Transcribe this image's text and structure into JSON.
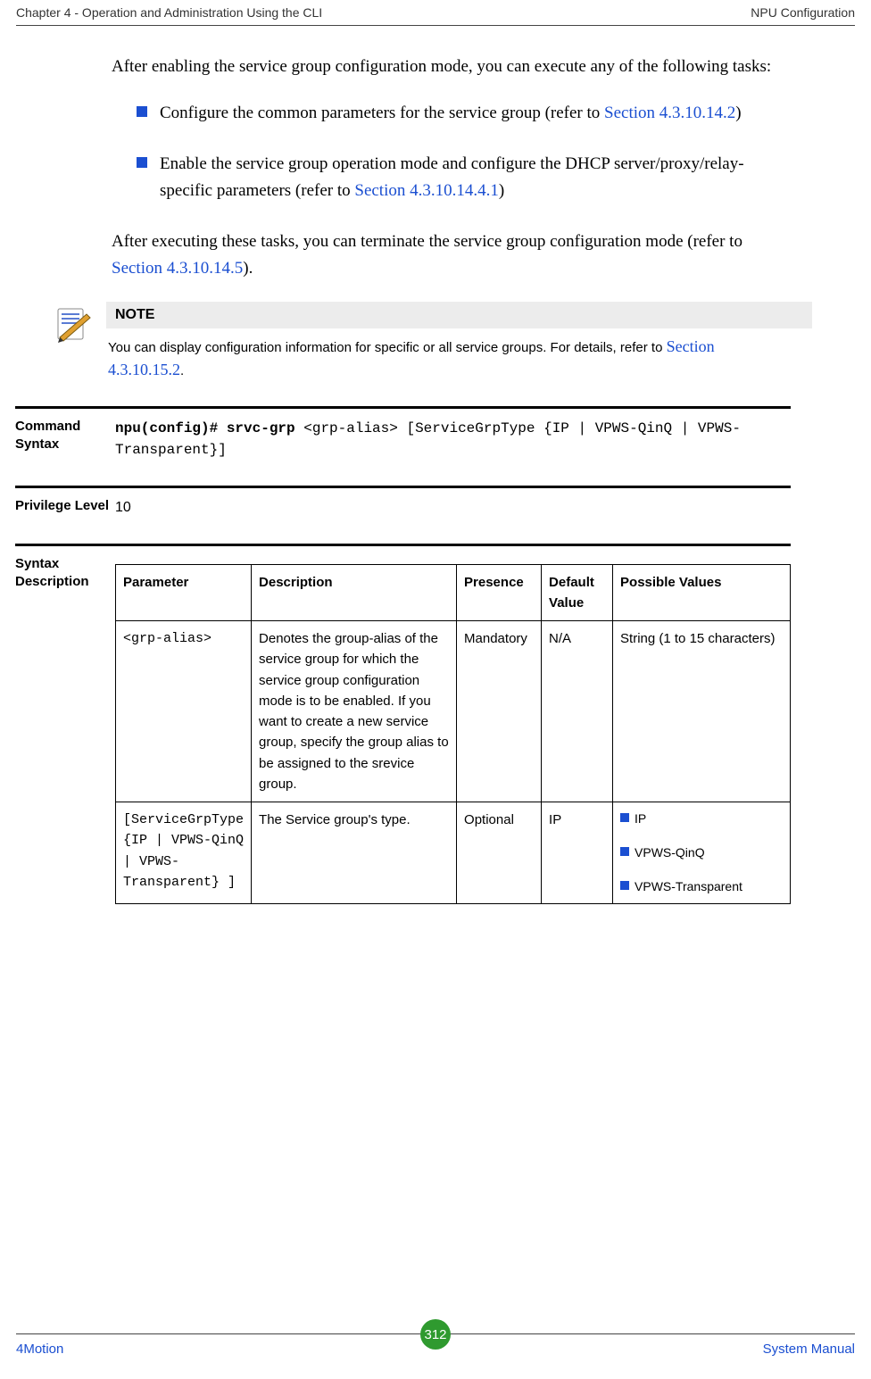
{
  "header": {
    "left": "Chapter 4 - Operation and Administration Using the CLI",
    "right": "NPU Configuration"
  },
  "intro": {
    "lead": "After enabling the service group configuration mode, you can execute any of the following tasks:",
    "bullets": [
      {
        "pre": "Configure the common parameters for the service group (refer to ",
        "link": "Section 4.3.10.14.2",
        "post": ")"
      },
      {
        "pre": "Enable the service group operation mode and configure the DHCP server/proxy/relay-specific parameters (refer to ",
        "link": "Section 4.3.10.14.4.1",
        "post": ")"
      }
    ],
    "after_pre": "After executing these tasks, you can terminate the service group configuration mode (refer to ",
    "after_link": "Section 4.3.10.14.5",
    "after_post": ")."
  },
  "note": {
    "title": "NOTE",
    "text_pre": "You can display configuration information for specific or all service groups. For details, refer to ",
    "link": "Section 4.3.10.15.2",
    "text_post": "."
  },
  "defs": {
    "command_syntax_label": "Command Syntax",
    "command_syntax_bold": "npu(config)# srvc-grp",
    "command_syntax_rest": " <grp-alias> [ServiceGrpType {IP | VPWS-QinQ | VPWS-Transparent}]",
    "privilege_level_label": "Privilege Level",
    "privilege_level_value": "10",
    "syntax_description_label": "Syntax Description"
  },
  "syntax_table": {
    "headers": {
      "parameter": "Parameter",
      "description": "Description",
      "presence": "Presence",
      "default_value": "Default Value",
      "possible_values": "Possible Values"
    },
    "rows": [
      {
        "parameter": "<grp-alias>",
        "description": "Denotes the group-alias of the service group for which the service group configuration mode is to be enabled. If you want to create a new service group, specify the group alias to be assigned to the srevice group.",
        "presence": "Mandatory",
        "default_value": "N/A",
        "possible_values_plain": "String (1 to 15 characters)"
      },
      {
        "parameter": "[ServiceGrpType {IP | VPWS-QinQ | VPWS-Transparent} ]",
        "description": "The Service group's type.",
        "presence": "Optional",
        "default_value": "IP",
        "possible_values_list": [
          "IP",
          "VPWS-QinQ",
          "VPWS-Transparent"
        ]
      }
    ]
  },
  "footer": {
    "left": "4Motion",
    "page": "312",
    "right": "System Manual"
  }
}
